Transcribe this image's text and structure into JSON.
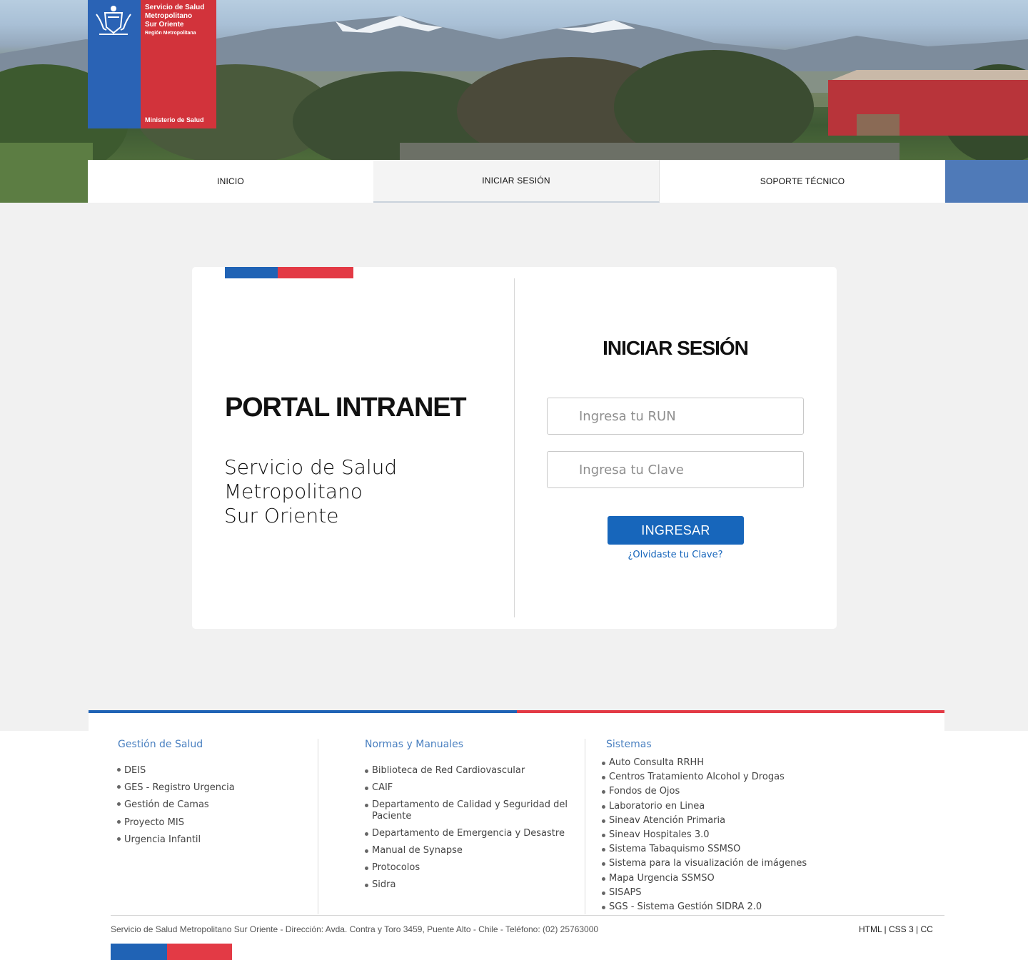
{
  "header": {
    "logo": {
      "org_line1": "Servicio de Salud",
      "org_line2": "Metropolitano",
      "org_line3": "Sur Oriente",
      "region": "Región Metropolitana",
      "ministry": "Ministerio de Salud"
    },
    "nav": [
      {
        "label": "INICIO"
      },
      {
        "label": "INICIAR SESIÓN"
      },
      {
        "label": "SOPORTE TÉCNICO"
      }
    ]
  },
  "colors": {
    "gob_blue": "#2063b5",
    "gob_red": "#e33a45",
    "button_blue": "#1766bb",
    "footer_heading": "#4a80c0"
  },
  "portal": {
    "title": "PORTAL INTRANET",
    "subtitle_lines": [
      "Servicio de Salud",
      "Metropolitano",
      "Sur Oriente"
    ]
  },
  "login": {
    "title": "INICIAR SESIÓN",
    "run_placeholder": "Ingresa tu RUN",
    "password_placeholder": "Ingresa tu Clave",
    "submit_label": "INGRESAR",
    "forgot_label": "¿Olvidaste tu Clave?"
  },
  "footer": {
    "columns": [
      {
        "heading": "Gestión de Salud",
        "links": [
          "DEIS",
          "GES - Registro Urgencia",
          "Gestión de Camas",
          "Proyecto MIS",
          "Urgencia Infantil"
        ]
      },
      {
        "heading": "Normas y Manuales",
        "links": [
          "Biblioteca de Red Cardiovascular",
          "CAIF",
          "Departamento de Calidad y Seguridad del Paciente",
          "Departamento de Emergencia y Desastre",
          "Manual de Synapse",
          "Protocolos",
          "Sidra"
        ]
      },
      {
        "heading": "Sistemas",
        "links": [
          "Auto Consulta RRHH",
          "Centros Tratamiento Alcohol y Drogas",
          "Fondos de Ojos",
          "Laboratorio en Linea",
          "Sineav Atención Primaria",
          "Sineav Hospitales 3.0",
          "Sistema Tabaquismo SSMSO",
          "Sistema para la visualización de imágenes",
          "Mapa Urgencia SSMSO",
          "SISAPS",
          "SGS - Sistema Gestión SIDRA 2.0"
        ]
      }
    ],
    "address": "Servicio de Salud Metropolitano Sur Oriente - Dirección: Avda. Contra y Toro 3459, Puente Alto - Chile - Teléfono: (02) 25763000",
    "tech_links": "HTML | CSS 3 | CC"
  }
}
